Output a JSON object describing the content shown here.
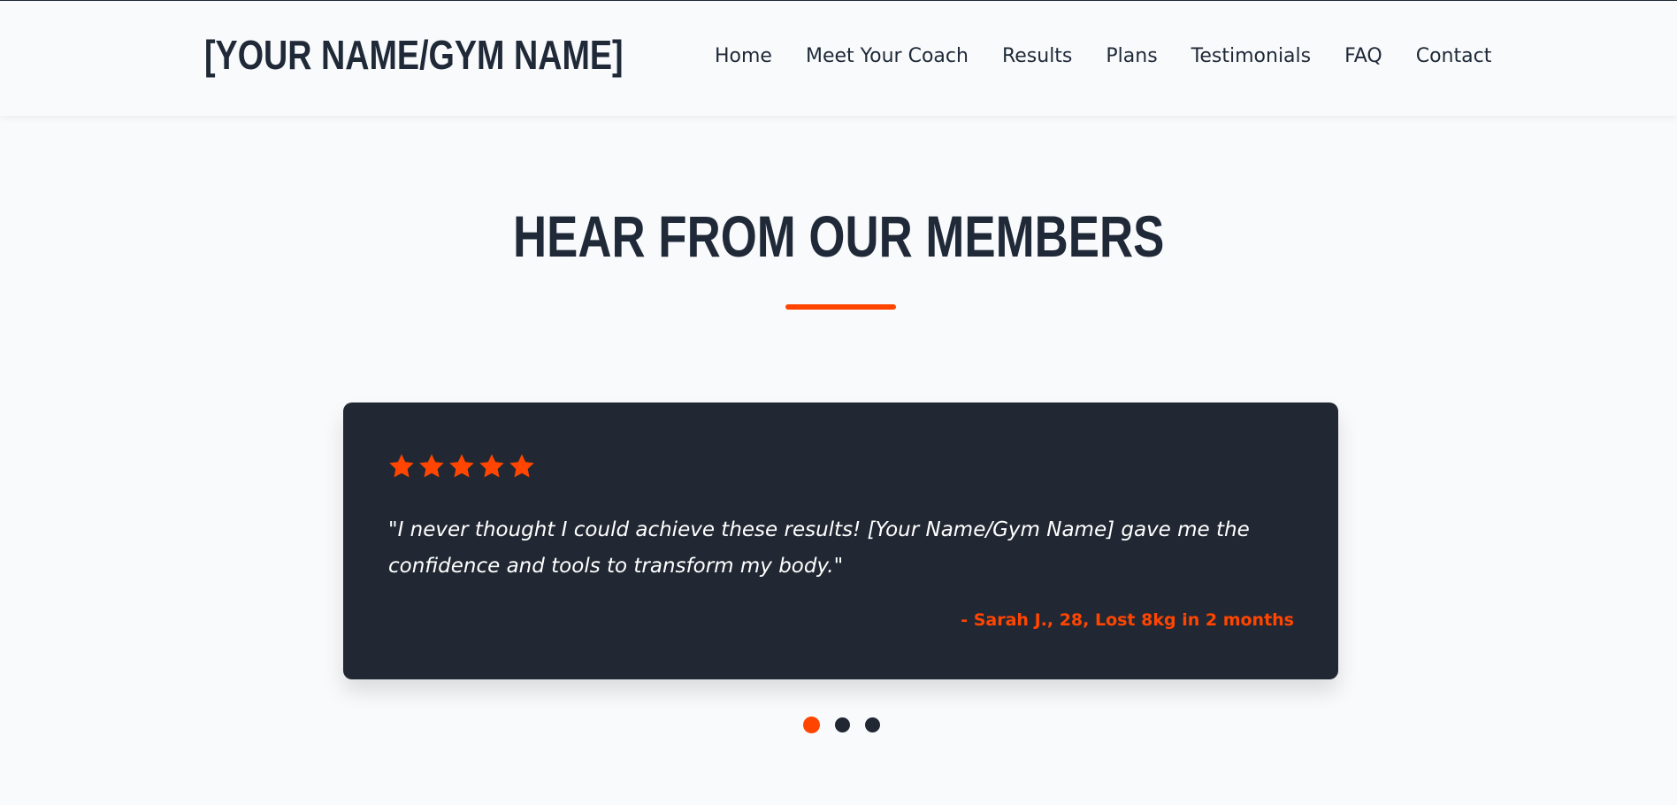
{
  "header": {
    "logo": "[YOUR NAME/GYM NAME]",
    "nav": [
      {
        "label": "Home"
      },
      {
        "label": "Meet Your Coach"
      },
      {
        "label": "Results"
      },
      {
        "label": "Plans"
      },
      {
        "label": "Testimonials"
      },
      {
        "label": "FAQ"
      },
      {
        "label": "Contact"
      }
    ]
  },
  "testimonials": {
    "title": "HEAR FROM OUR MEMBERS",
    "card": {
      "rating": 5,
      "quote": "\"I never thought I could achieve these results! [Your Name/Gym Name] gave me the confidence and tools to transform my body.\"",
      "author": "- Sarah J., 28, Lost 8kg in 2 months"
    },
    "carousel": {
      "total": 3,
      "active_index": 0
    }
  },
  "colors": {
    "accent": "#ff4500",
    "dark": "#222833",
    "background": "#f8fafc",
    "text": "#1f2937"
  }
}
